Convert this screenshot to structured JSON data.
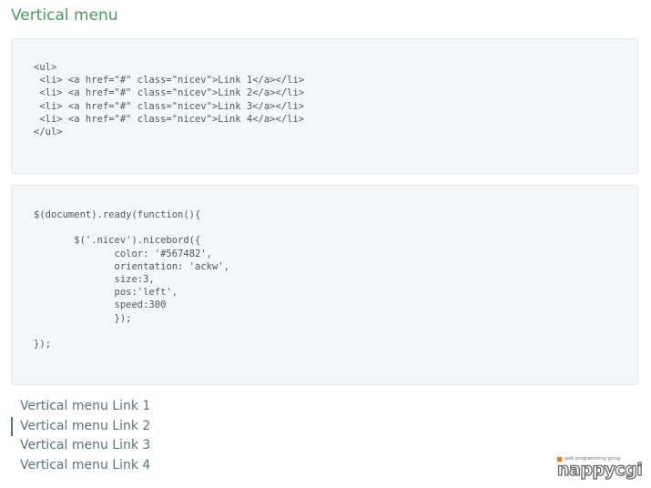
{
  "page": {
    "title": "Vertical menu"
  },
  "code": {
    "html": "<ul>\n <li> <a href=\"#\" class=\"nicev\">Link 1</a></li>\n <li> <a href=\"#\" class=\"nicev\">Link 2</a></li>\n <li> <a href=\"#\" class=\"nicev\">Link 3</a></li>\n <li> <a href=\"#\" class=\"nicev\">Link 4</a></li>\n</ul>",
    "js": "$(document).ready(function(){\n\n       $('.nicev').nicebord({\n              color: '#567482',\n              orientation: 'ackw',\n              size:3,\n              pos:'left',\n              speed:300\n              });\n\n});"
  },
  "menu": {
    "items": [
      {
        "label": "Vertical menu Link 1",
        "href": "#"
      },
      {
        "label": "Vertical menu Link 2",
        "href": "#"
      },
      {
        "label": "Vertical menu Link 3",
        "href": "#"
      },
      {
        "label": "Vertical menu Link 4",
        "href": "#"
      }
    ],
    "active_index": 1
  },
  "logo": {
    "tagline": "web programming group",
    "wordmark": "nappycgi"
  },
  "colors": {
    "title": "#3fa15b",
    "link": "#567482",
    "code_bg": "#f4f7fa",
    "logo_accent": "#e57a2e"
  }
}
